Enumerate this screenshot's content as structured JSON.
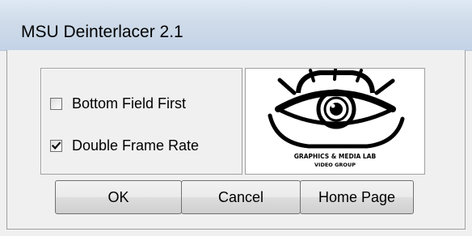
{
  "window": {
    "title": "MSU Deinterlacer 2.1"
  },
  "options": {
    "bottom_field_first": {
      "label": "Bottom Field First",
      "checked": false
    },
    "double_frame_rate": {
      "label": "Double Frame Rate",
      "checked": true
    }
  },
  "logo": {
    "line1": "GRAPHICS & MEDIA LAB",
    "line2": "VIDEO GROUP",
    "icon": "eye-logo-icon"
  },
  "buttons": {
    "ok_label": "OK",
    "cancel_label": "Cancel",
    "home_label": "Home Page"
  },
  "colors": {
    "titlebar": "#c8d7e9",
    "dialog_bg": "#f0f0f0",
    "border": "#a0a0a0"
  }
}
